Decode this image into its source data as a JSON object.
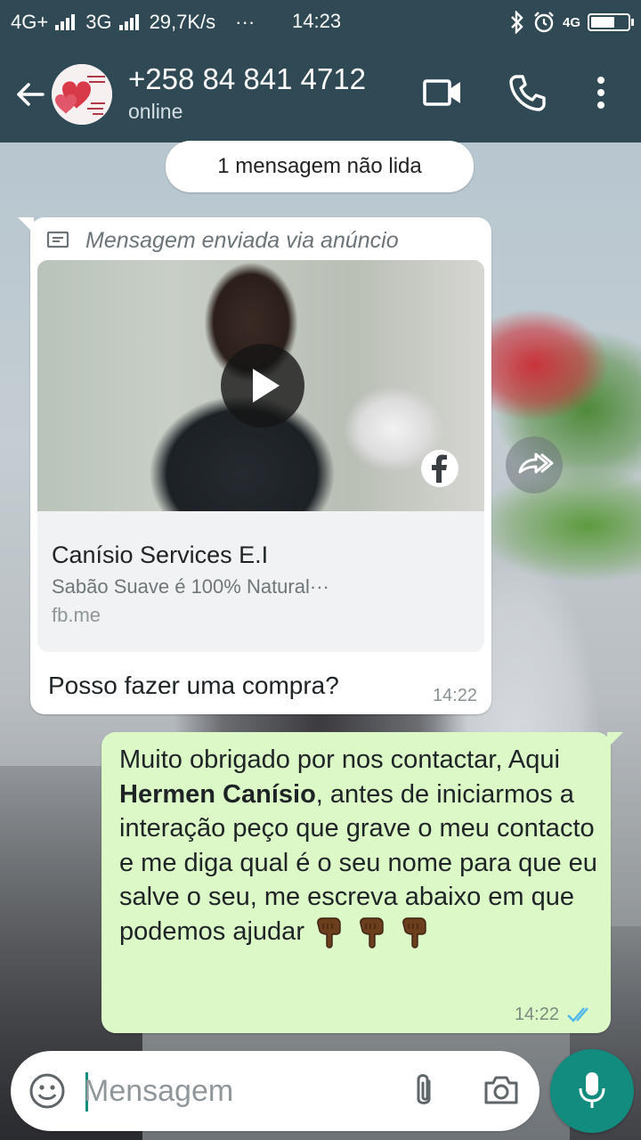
{
  "status_bar": {
    "network_left": "4G+",
    "network_mid": "3G",
    "speed": "29,7K/s",
    "dots": "···",
    "time": "14:23",
    "network_right": "4G"
  },
  "header": {
    "contact_name": "+258 84 841 4712",
    "contact_status": "online"
  },
  "unread_pill": "1 mensagem não lida",
  "incoming": {
    "ad_label": "Mensagem enviada via anúncio",
    "ad_title": "Canísio Services E.I",
    "ad_description": "Sabão Suave é 100% Natural···",
    "ad_link": "fb.me",
    "text": "Posso fazer uma compra?",
    "time": "14:22"
  },
  "outgoing": {
    "text_part1": "Muito obrigado por nos contactar, Aqui ",
    "text_bold": "Hermen Canísio",
    "text_part2": ", antes de iniciarmos a interação peço que grave o meu contacto e me diga qual é o seu nome para que eu salve o seu, me escreva abaixo em que podemos ajudar",
    "emoji": "👇🏾👇🏾👇🏾",
    "time": "14:22",
    "status": "read"
  },
  "input": {
    "placeholder": "Mensagem"
  },
  "colors": {
    "header_bg": "#2f4a55",
    "outgoing_bubble": "#dcf8c6",
    "incoming_bubble": "#ffffff",
    "accent": "#128c7e",
    "read_tick": "#4fb6ec"
  },
  "icons": [
    "back-arrow-icon",
    "avatar",
    "video-call-icon",
    "phone-call-icon",
    "more-menu-icon",
    "ad-message-icon",
    "play-icon",
    "facebook-icon",
    "forward-icon",
    "double-tick-icon",
    "emoji-icon",
    "attach-icon",
    "camera-icon",
    "mic-icon"
  ]
}
